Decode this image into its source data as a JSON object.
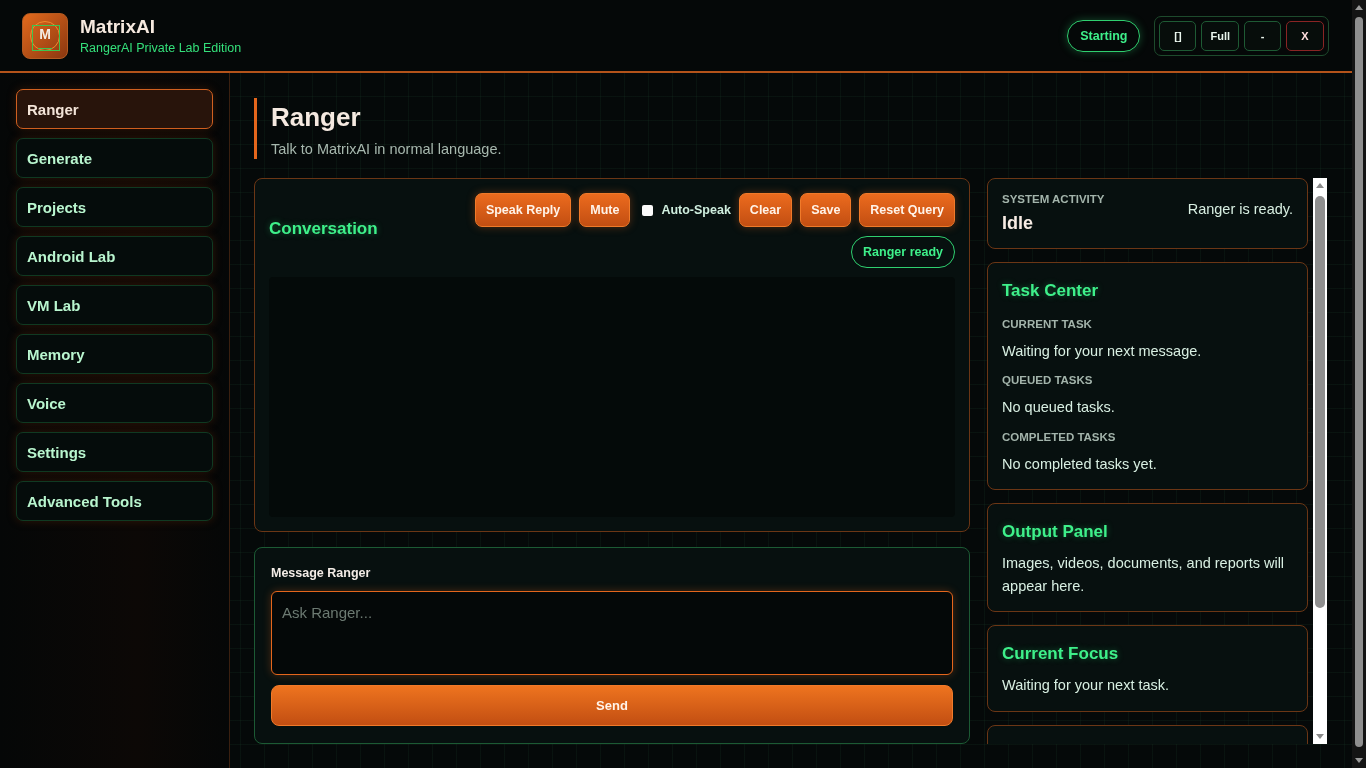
{
  "app": {
    "logo_letter": "M",
    "name": "MatrixAI",
    "subtitle": "RangerAI Private Lab Edition"
  },
  "status_pill": "Starting",
  "window_controls": [
    {
      "label": "[]",
      "kind": "normal"
    },
    {
      "label": "Full",
      "kind": "normal"
    },
    {
      "label": "-",
      "kind": "normal"
    },
    {
      "label": "X",
      "kind": "close"
    }
  ],
  "sidebar": {
    "items": [
      {
        "label": "Ranger",
        "selected": true
      },
      {
        "label": "Generate",
        "selected": false
      },
      {
        "label": "Projects",
        "selected": false
      },
      {
        "label": "Android Lab",
        "selected": false
      },
      {
        "label": "VM Lab",
        "selected": false
      },
      {
        "label": "Memory",
        "selected": false
      },
      {
        "label": "Voice",
        "selected": false
      },
      {
        "label": "Settings",
        "selected": false
      },
      {
        "label": "Advanced Tools",
        "selected": false
      }
    ]
  },
  "page": {
    "title": "Ranger",
    "subtitle": "Talk to MatrixAI in normal language."
  },
  "conversation": {
    "title": "Conversation",
    "toolbar": [
      {
        "kind": "button",
        "label": "Speak Reply"
      },
      {
        "kind": "button",
        "label": "Mute"
      },
      {
        "kind": "checkbox",
        "label": "Auto-Speak",
        "checked": false
      },
      {
        "kind": "button",
        "label": "Clear"
      },
      {
        "kind": "button",
        "label": "Save"
      },
      {
        "kind": "button",
        "label": "Reset Query"
      }
    ],
    "status": "Ranger ready"
  },
  "composer": {
    "label": "Message Ranger",
    "placeholder": "Ask Ranger...",
    "send": "Send"
  },
  "right_panel": {
    "activity": {
      "label": "SYSTEM ACTIVITY",
      "state": "Idle",
      "message": "Ranger is ready."
    },
    "cards": [
      {
        "kind": "sections",
        "title": "Task Center",
        "sections": [
          {
            "label": "CURRENT TASK",
            "text": "Waiting for your next message."
          },
          {
            "label": "QUEUED TASKS",
            "text": "No queued tasks."
          },
          {
            "label": "COMPLETED TASKS",
            "text": "No completed tasks yet."
          }
        ]
      },
      {
        "kind": "text",
        "title": "Output Panel",
        "text": "Images, videos, documents, and reports will appear here."
      },
      {
        "kind": "text",
        "title": "Current Focus",
        "text": "Waiting for your next task."
      },
      {
        "kind": "clipped"
      }
    ]
  }
}
